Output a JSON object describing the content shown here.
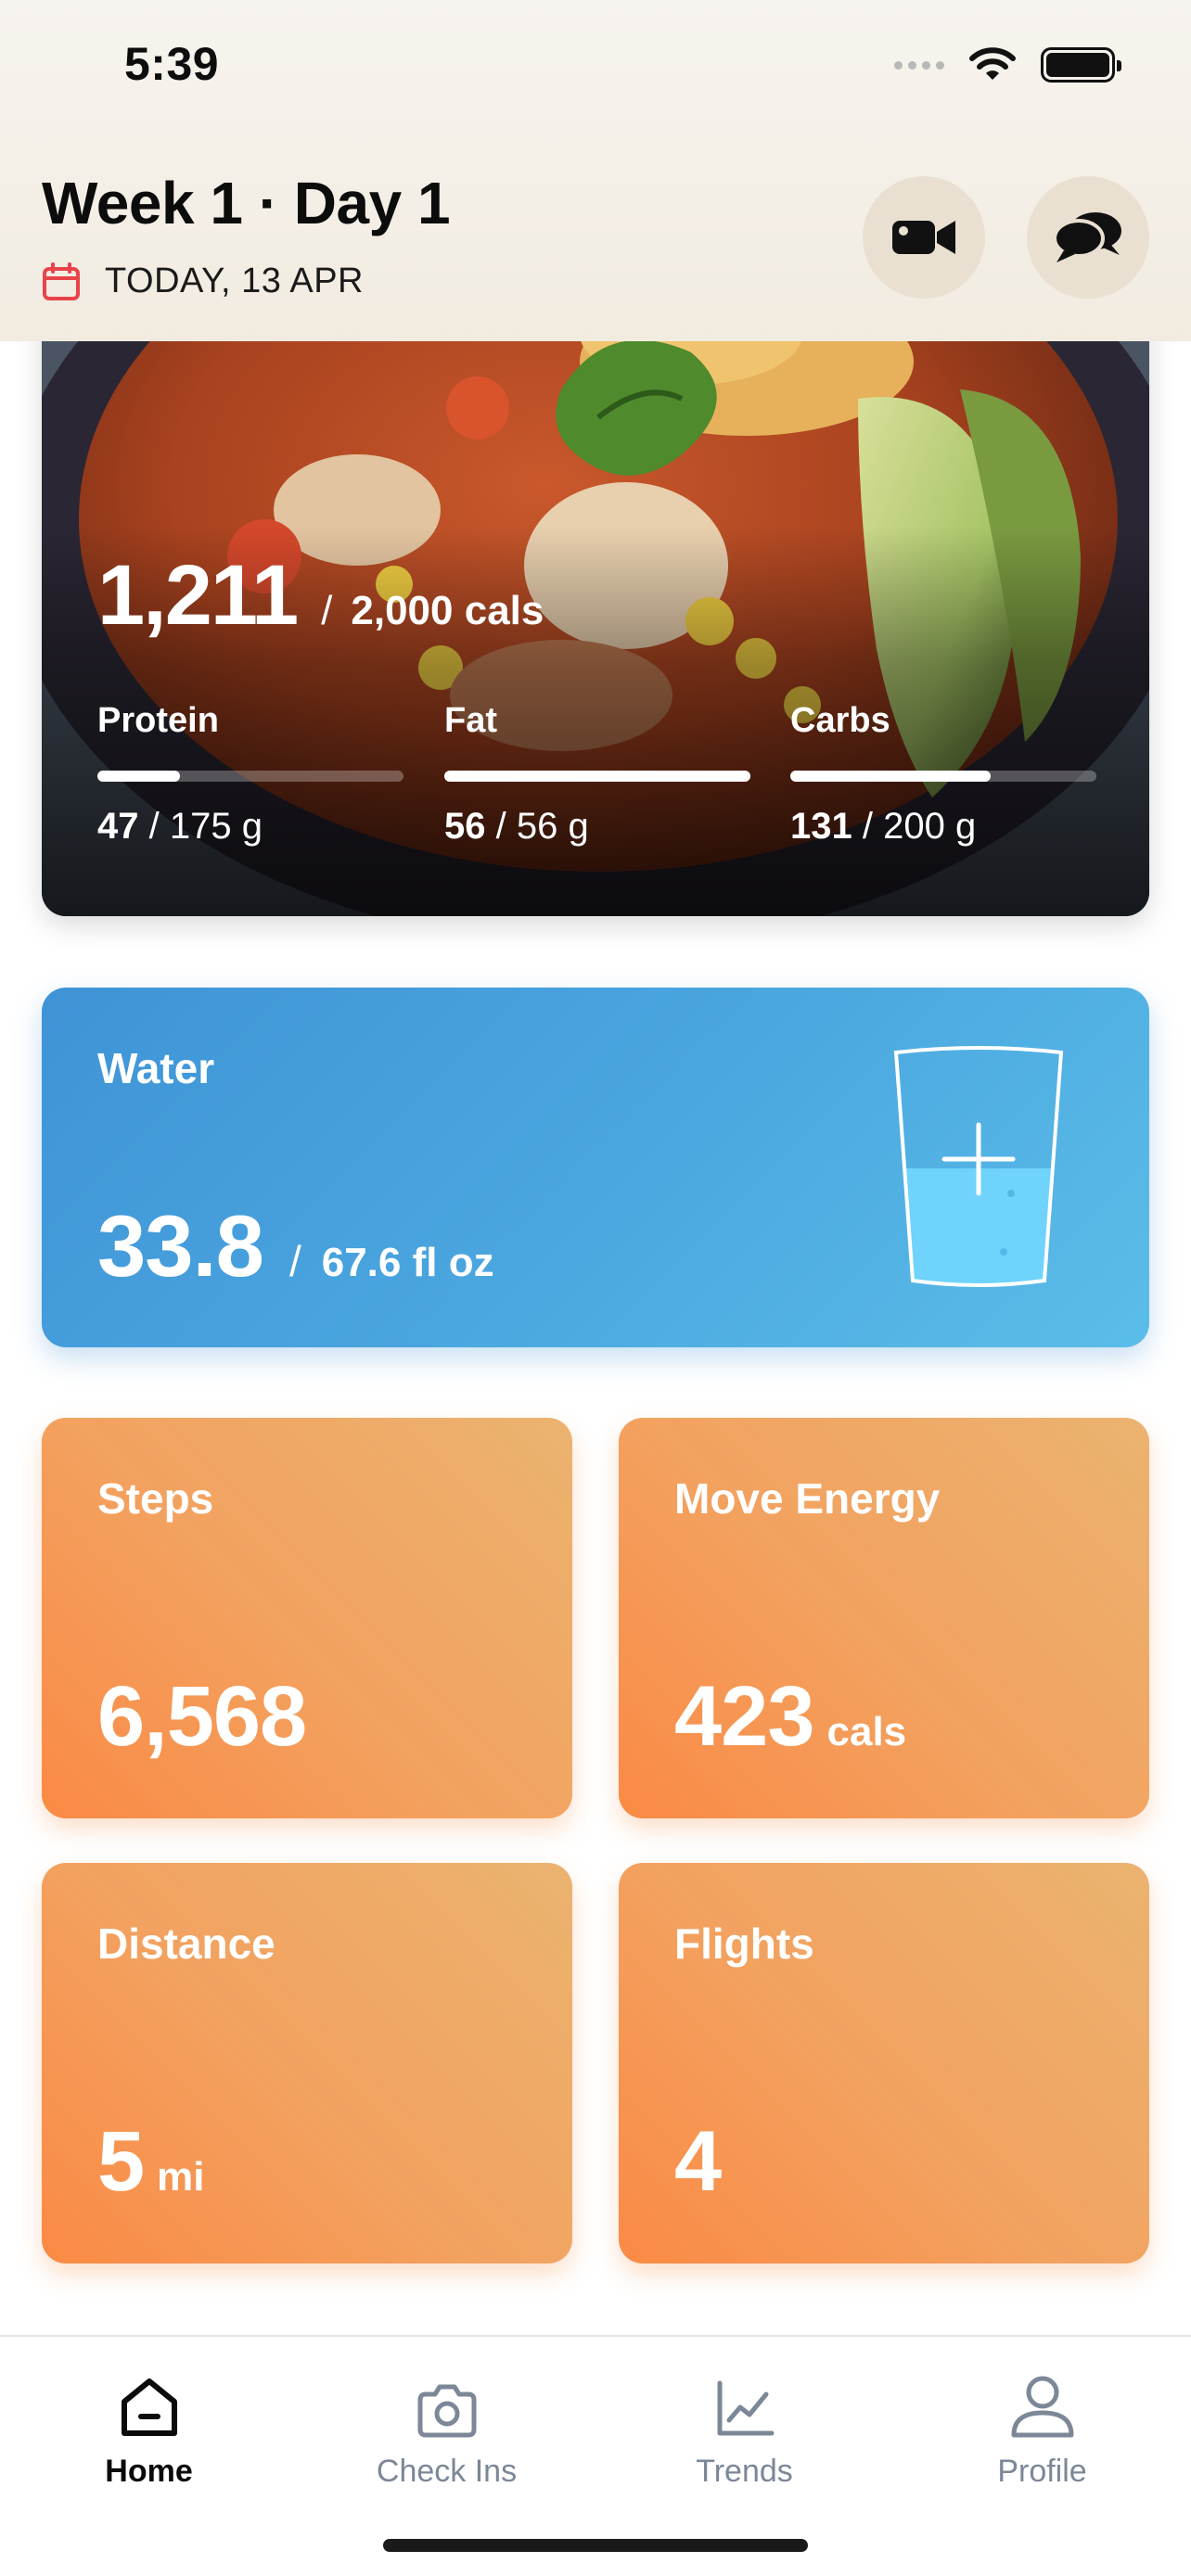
{
  "status_bar": {
    "time": "5:39"
  },
  "header": {
    "title": "Week 1 · Day 1",
    "date": "TODAY, 13 APR",
    "video_icon": "video-camera-icon",
    "chat_icon": "chat-bubbles-icon"
  },
  "nutrition": {
    "calories_consumed": "1,211",
    "calories_separator": "/",
    "calories_goal": "2,000 cals",
    "macros": [
      {
        "name": "Protein",
        "current": "47",
        "goal": "/ 175 g",
        "progress": 0.27
      },
      {
        "name": "Fat",
        "current": "56",
        "goal": "/ 56 g",
        "progress": 1.0
      },
      {
        "name": "Carbs",
        "current": "131",
        "goal": "/ 200 g",
        "progress": 0.655
      }
    ]
  },
  "water": {
    "label": "Water",
    "current": "33.8",
    "separator": "/",
    "goal": "67.6 fl oz",
    "level": 0.5
  },
  "stats": [
    {
      "label": "Steps",
      "value": "6,568",
      "unit": ""
    },
    {
      "label": "Move Energy",
      "value": "423",
      "unit": "cals"
    },
    {
      "label": "Distance",
      "value": "5",
      "unit": "mi"
    },
    {
      "label": "Flights",
      "value": "4",
      "unit": ""
    }
  ],
  "tabs": [
    {
      "label": "Home",
      "icon": "home-icon",
      "active": true
    },
    {
      "label": "Check Ins",
      "icon": "camera-icon",
      "active": false
    },
    {
      "label": "Trends",
      "icon": "chart-icon",
      "active": false
    },
    {
      "label": "Profile",
      "icon": "person-icon",
      "active": false
    }
  ],
  "colors": {
    "water_gradient_start": "#3f93d6",
    "water_gradient_end": "#5bbde8",
    "stat_gradient_start": "#fa8a45",
    "stat_gradient_end": "#ebb370",
    "date_icon": "#e8434a"
  }
}
